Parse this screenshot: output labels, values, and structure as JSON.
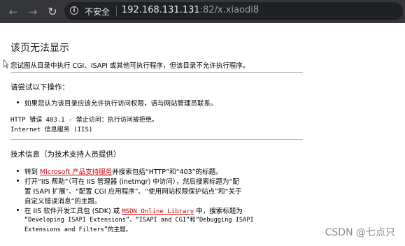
{
  "browser": {
    "security_label": "不安全",
    "url_host": "192.168.131.131",
    "url_rest": ":82/x.xiaodi8"
  },
  "page": {
    "title": "该页无法显示",
    "intro": "您试图从目录中执行 CGI、ISAPI 或其他可执行程序，但该目录不允许执行程序。",
    "try_heading": "请尝试以下操作：",
    "try_item": "如果您认为该目录应该允许执行访问权限，请与网站管理员联系。",
    "error_line1": "HTTP 错误 403.1 - 禁止访问：执行访问被拒绝。",
    "error_line2": "Internet 信息服务 (IIS)",
    "tech_heading": "技术信息（为技术支持人员提供）",
    "tech1_pre": "转到 ",
    "tech1_link": "Microsoft 产品支持服务",
    "tech1_post": "并搜索包括“HTTP”和“403”的标题。",
    "tech2_line1": "打开“IIS 帮助”（可在 IIS 管理器 (inetmgr) 中访问），然后搜索标题为“配",
    "tech2_line2": "置 ISAPI 扩展”、“配置 CGI 应用程序”、“使用网站权限保护站点”和“关于",
    "tech2_line3": "自定义错误消息”的主题。",
    "tech3_pre": "在 IIS 软件开发工具包 (SDK) 或 ",
    "tech3_link": "MSDN Online Library",
    "tech3_post": " 中，搜索标题为",
    "tech3_line2": "“Developing ISAPI Extensions”、“ISAPI and CGI”和“Debugging ISAPI",
    "tech3_line3": "Extensions and Filters”的主题。"
  },
  "watermark": "CSDN @七点只",
  "colors": {
    "link": "#cc0000",
    "chrome": "#35363a",
    "omnibox": "#202124"
  }
}
